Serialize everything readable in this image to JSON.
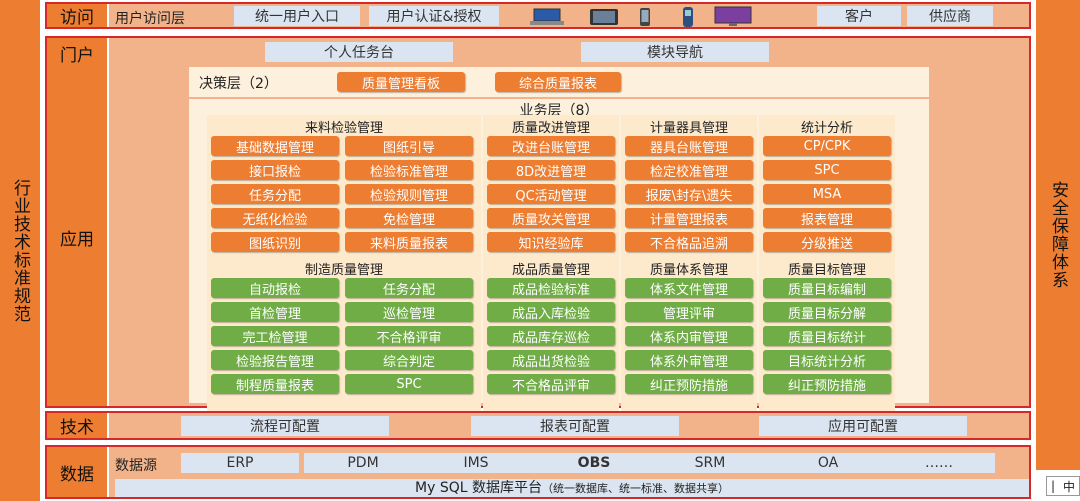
{
  "sides": {
    "left": "行业技术标准规范",
    "right": "安全保障体系"
  },
  "access": {
    "label": "访问",
    "user_layer": "用户访问层",
    "entry": "统一用户入口",
    "auth": "用户认证&授权",
    "devices": [
      "laptop-icon",
      "tablet-icon",
      "phone-icon",
      "handheld-scanner-icon",
      "monitor-icon"
    ],
    "customer": "客户",
    "supplier": "供应商"
  },
  "portal": {
    "label": "门户",
    "tasks": "个人任务台",
    "nav": "模块导航"
  },
  "app": {
    "label": "应用",
    "decision": {
      "title": "决策层（2）",
      "items": [
        "质量管理看板",
        "综合质量报表"
      ]
    },
    "business_title": "业务层（8）",
    "row1": [
      {
        "title": "来料检验管理",
        "items": [
          "基础数据管理",
          "图纸引导",
          "接口报检",
          "检验标准管理",
          "任务分配",
          "检验规则管理",
          "无纸化检验",
          "免检管理",
          "图纸识别",
          "来料质量报表"
        ]
      },
      {
        "title": "质量改进管理",
        "items": [
          "改进台账管理",
          "8D改进管理",
          "QC活动管理",
          "质量攻关管理",
          "知识经验库"
        ]
      },
      {
        "title": "计量器具管理",
        "items": [
          "器具台账管理",
          "检定校准管理",
          "报废\\封存\\遗失",
          "计量管理报表",
          "不合格品追溯"
        ]
      },
      {
        "title": "统计分析",
        "items": [
          "CP/CPK",
          "SPC",
          "MSA",
          "报表管理",
          "分级推送"
        ]
      }
    ],
    "row2": [
      {
        "title": "制造质量管理",
        "items": [
          "自动报检",
          "任务分配",
          "首检管理",
          "巡检管理",
          "完工检管理",
          "不合格评审",
          "检验报告管理",
          "综合判定",
          "制程质量报表",
          "SPC"
        ]
      },
      {
        "title": "成品质量管理",
        "items": [
          "成品检验标准",
          "成品入库检验",
          "成品库存巡检",
          "成品出货检验",
          "不合格品评审"
        ]
      },
      {
        "title": "质量体系管理",
        "items": [
          "体系文件管理",
          "管理评审",
          "体系内审管理",
          "体系外审管理",
          "纠正预防措施"
        ]
      },
      {
        "title": "质量目标管理",
        "items": [
          "质量目标编制",
          "质量目标分解",
          "质量目标统计",
          "目标统计分析",
          "纠正预防措施"
        ]
      }
    ]
  },
  "tech": {
    "label": "技术",
    "items": [
      "流程可配置",
      "报表可配置",
      "应用可配置"
    ]
  },
  "data": {
    "label": "数据",
    "source_label": "数据源",
    "sources": [
      "ERP",
      "PDM",
      "IMS",
      "OBS",
      "SRM",
      "OA",
      "……"
    ],
    "platform": "My SQL 数据库平台",
    "platform_note": "（统一数据库、统一标准、数据共享）"
  },
  "badge": {
    "left": "|",
    "right": "中"
  }
}
